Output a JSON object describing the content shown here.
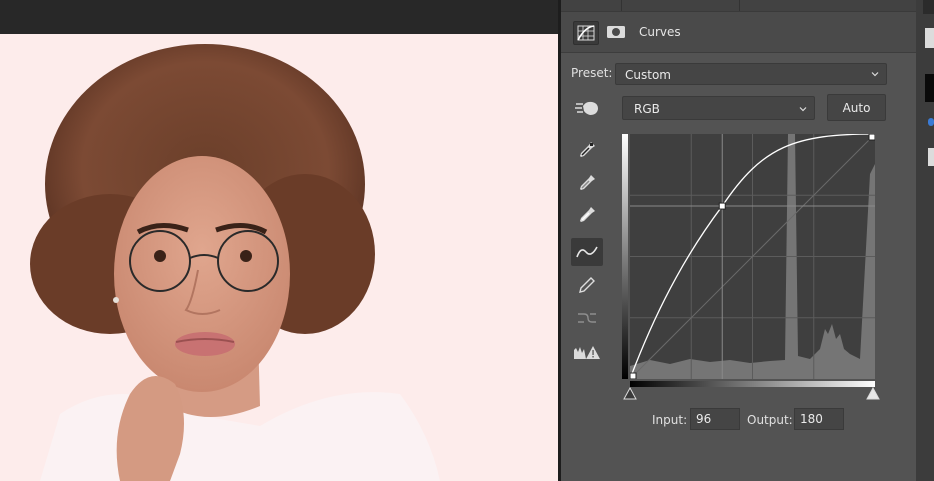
{
  "panel": {
    "title": "Curves",
    "preset": {
      "label": "Preset:",
      "value": "Custom"
    },
    "channel": {
      "value": "RGB"
    },
    "auto_label": "Auto",
    "input": {
      "label": "Input:",
      "value": "96"
    },
    "output": {
      "label": "Output:",
      "value": "180"
    }
  },
  "curve_points": [
    {
      "input": 0,
      "output": 0
    },
    {
      "input": 96,
      "output": 180
    },
    {
      "input": 255,
      "output": 255
    }
  ],
  "colors": {
    "panel_bg": "#535353",
    "canvas_bg": "#fdeceb",
    "accent": "#3a7bd5"
  }
}
